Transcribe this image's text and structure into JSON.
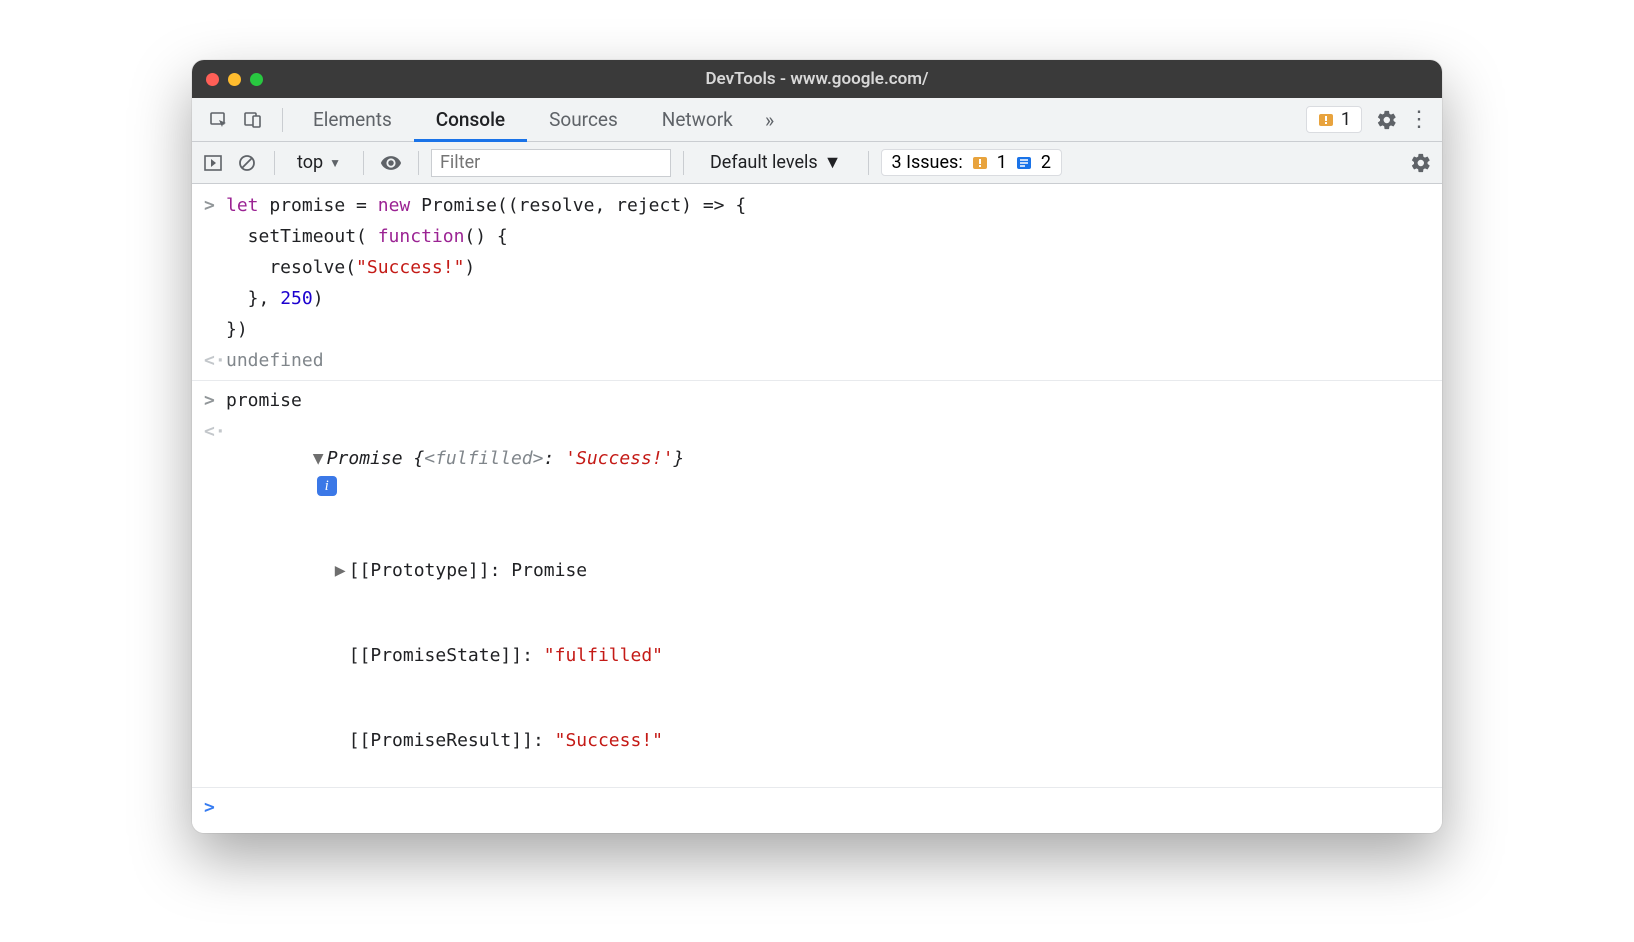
{
  "window": {
    "title": "DevTools - www.google.com/"
  },
  "tabs": {
    "elements": "Elements",
    "console": "Console",
    "sources": "Sources",
    "network": "Network",
    "overflow_glyph": "»"
  },
  "header_right": {
    "warning_count": "1"
  },
  "subbar": {
    "context": "top",
    "filter_placeholder": "Filter",
    "levels_label": "Default levels",
    "issues_label": "3 Issues:",
    "issue_warn_count": "1",
    "issue_info_count": "2"
  },
  "console": {
    "input1_line1": "let promise = new Promise((resolve, reject) => {",
    "input1_line2": "  setTimeout( function() {",
    "input1_line3": "    resolve(\"Success!\")",
    "input1_line4": "  }, 250)",
    "input1_line5": "})",
    "result1": "undefined",
    "input2": "promise",
    "result2_head_prefix": "Promise",
    "result2_head_open": " {",
    "result2_head_state": "<fulfilled>",
    "result2_head_colon": ": ",
    "result2_head_value": "'Success!'",
    "result2_head_close": "}",
    "proto_label": "[[Prototype]]",
    "proto_value": "Promise",
    "state_label": "[[PromiseState]]",
    "state_value": "\"fulfilled\"",
    "res_label": "[[PromiseResult]]",
    "res_value": "\"Success!\"",
    "gutter_in": ">",
    "gutter_out": "<",
    "expand_down": "▼",
    "expand_right": "▶"
  }
}
